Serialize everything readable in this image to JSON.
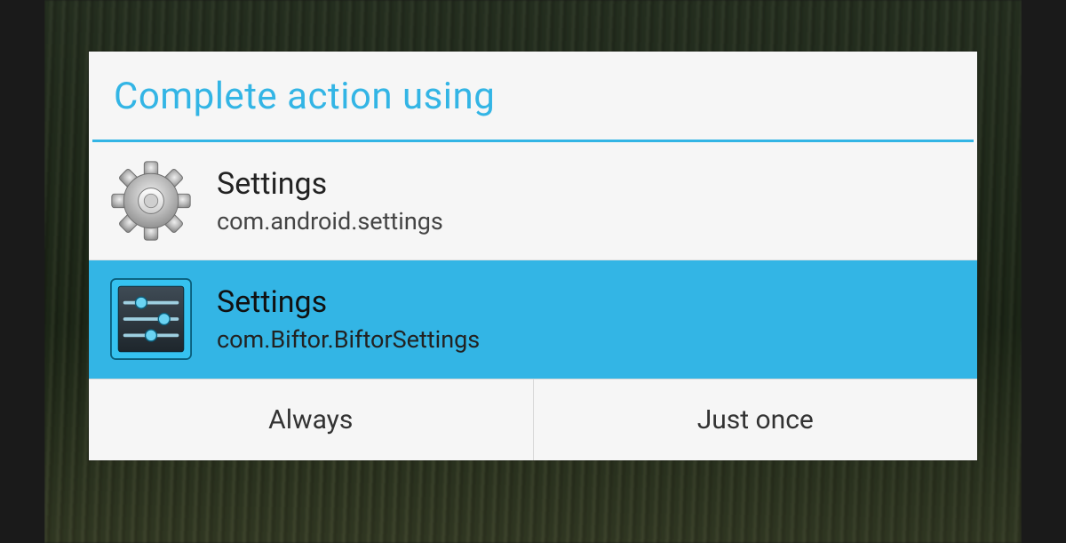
{
  "dialog": {
    "title": "Complete action using",
    "accent_color": "#33b5e5"
  },
  "apps": [
    {
      "name": "Settings",
      "package": "com.android.settings",
      "icon": "gear-icon",
      "selected": false
    },
    {
      "name": "Settings",
      "package": "com.Biftor.BiftorSettings",
      "icon": "sliders-icon",
      "selected": true
    }
  ],
  "buttons": {
    "always": "Always",
    "just_once": "Just once"
  }
}
